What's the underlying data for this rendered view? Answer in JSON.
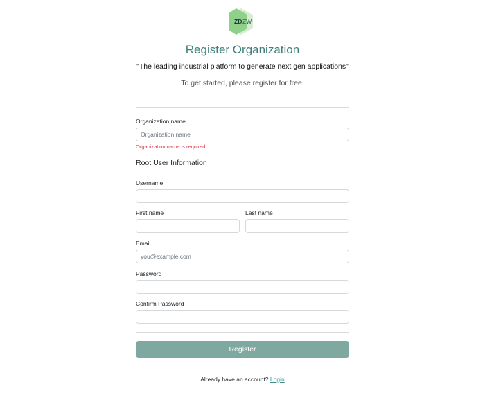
{
  "brand": {
    "logo_text_bold": "ZD",
    "logo_text_light": "ZW",
    "colors": {
      "accent": "#3f7f78",
      "logo_green": "#8fd18b",
      "logo_light": "#d7ecd3",
      "button": "#7fa8a0",
      "error": "#dc3545",
      "link": "#3f8f8a"
    }
  },
  "header": {
    "title": "Register Organization",
    "tagline": "\"The leading industrial platform to generate next gen applications\"",
    "subtitle": "To get started, please register for free."
  },
  "form": {
    "organization": {
      "label": "Organization name",
      "placeholder": "Organization name",
      "value": "",
      "error": "Organization name is required."
    },
    "root_user_heading": "Root User Information",
    "username": {
      "label": "Username",
      "placeholder": "",
      "value": ""
    },
    "first_name": {
      "label": "First name",
      "placeholder": "",
      "value": ""
    },
    "last_name": {
      "label": "Last name",
      "placeholder": "",
      "value": ""
    },
    "email": {
      "label": "Email",
      "placeholder": "you@example.com",
      "value": ""
    },
    "password": {
      "label": "Password",
      "placeholder": "",
      "value": ""
    },
    "confirm_password": {
      "label": "Confirm Password",
      "placeholder": "",
      "value": ""
    },
    "submit_label": "Register"
  },
  "footer": {
    "prompt": "Already have an account?",
    "login_link": "Login"
  }
}
